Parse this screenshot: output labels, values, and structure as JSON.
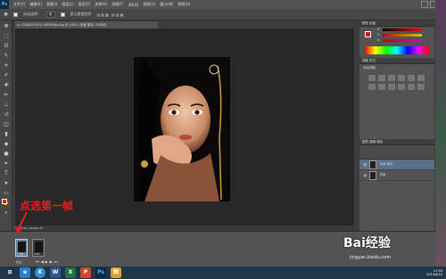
{
  "app": {
    "logo": "Ps",
    "menu": [
      "文件(F)",
      "编辑(E)",
      "图像(I)",
      "图层(L)",
      "类型(Y)",
      "选择(S)",
      "滤镜(T)",
      "3D(D)",
      "视图(V)",
      "窗口(W)",
      "帮助(H)"
    ]
  },
  "options_bar": {
    "auto_select_label": "自动选择：",
    "auto_select_value": "组",
    "show_transform_label": "显示变换控件"
  },
  "document": {
    "tab_title": "u=1282615593,1909918a.jpg @ 100% (背景 副本, RGB/8)",
    "status": "文档:411.2K/844.4K"
  },
  "panels": {
    "color": {
      "title": "颜色  色板",
      "sliders": [
        "R",
        "G",
        "B"
      ]
    },
    "adjustments": {
      "title": "调整  样式",
      "add_label": "添加调整"
    },
    "layers": {
      "title": "图层  通道  路径",
      "items": [
        {
          "name": "背景 副本",
          "selected": true
        },
        {
          "name": "背景",
          "selected": false
        }
      ]
    }
  },
  "timeline": {
    "frames": [
      {
        "delay": "0 秒▼",
        "selected": true
      },
      {
        "delay": "0.2▼",
        "selected": false
      }
    ],
    "loop": "永远"
  },
  "annotation": "点选第一帧",
  "watermark": {
    "text": "Bai经验",
    "sub": "jingyan.baidu.com"
  },
  "taskbar": {
    "apps": [
      "⊞",
      "e",
      "K",
      "W",
      "X",
      "P",
      "Ps",
      "图"
    ],
    "time": "21:50",
    "date": "2014/6/10"
  },
  "colors": {
    "accent_red": "#e22020",
    "ps_blue": "#4bb1ff"
  }
}
